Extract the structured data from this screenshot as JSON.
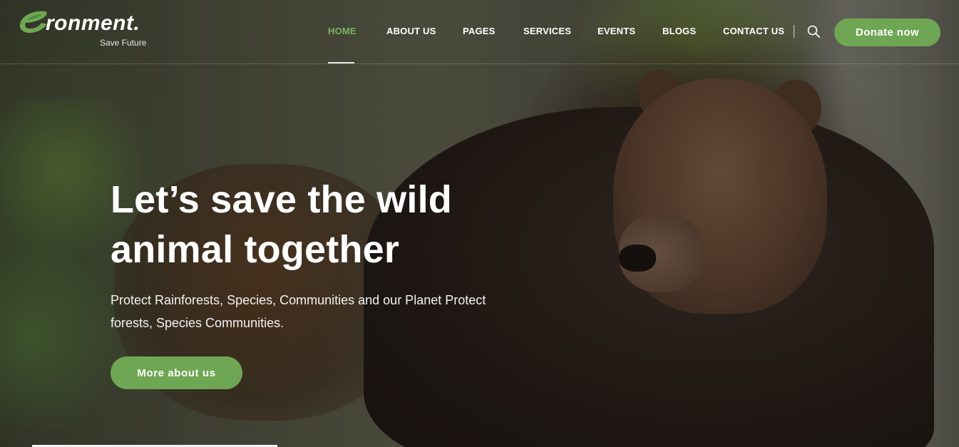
{
  "brand": {
    "name": "ronment.",
    "tagline": "Save Future",
    "accent": "#6fa653",
    "logo_icon": "leaf-e-icon"
  },
  "nav": {
    "items": [
      {
        "label": "HOME",
        "active": true
      },
      {
        "label": "ABOUT US"
      },
      {
        "label": "PAGES"
      },
      {
        "label": "SERVICES"
      },
      {
        "label": "EVENTS"
      },
      {
        "label": "BLOGS"
      },
      {
        "label": "CONTACT US"
      }
    ],
    "search_icon": "search-icon",
    "donate_label": "Donate now"
  },
  "hero": {
    "title_line1": "Let’s save the wild",
    "title_line2": "animal together",
    "subtitle_line1": "Protect Rainforests, Species, Communities and our Planet Protect",
    "subtitle_line2": "forests, Species Communities.",
    "button_label": "More about us",
    "active_nav_color": "#7db35f"
  }
}
